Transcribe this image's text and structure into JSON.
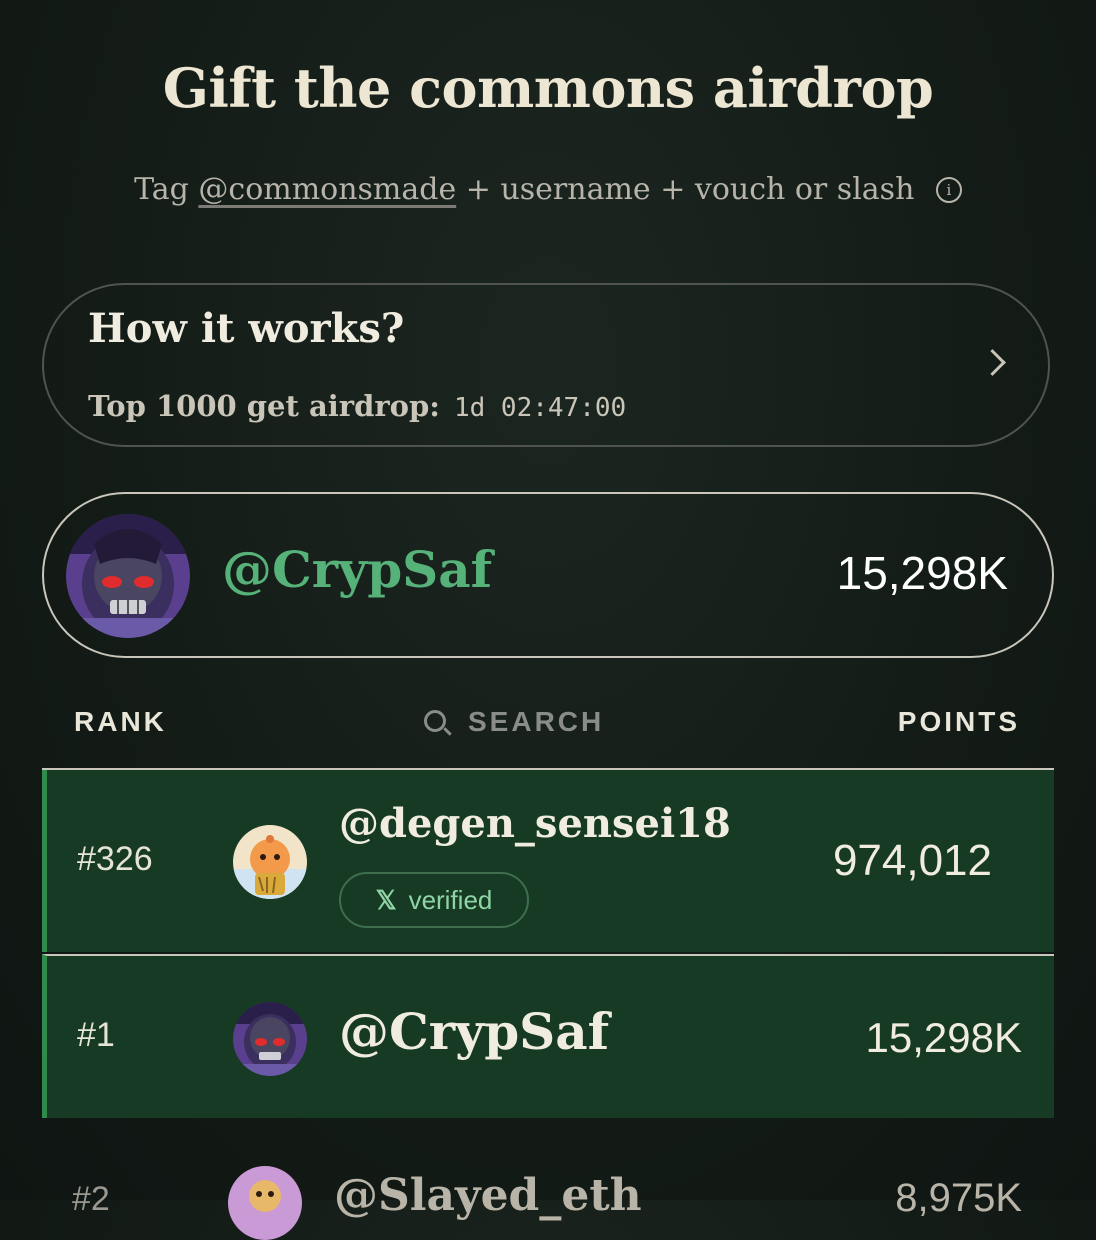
{
  "header": {
    "title": "Gift the commons airdrop",
    "subtitle_prefix": "Tag",
    "subtitle_handle": "@commonsmade",
    "subtitle_suffix": "+ username + vouch or slash",
    "info_icon": "info-icon"
  },
  "how_it_works": {
    "title": "How it works?",
    "subtitle": "Top 1000 get airdrop:",
    "timer": "1d 02:47:00",
    "chevron_icon": "chevron-right-icon"
  },
  "current_user": {
    "username": "@CrypSaf",
    "points": "15,298K",
    "avatar_icon": "avatar"
  },
  "table_header": {
    "rank": "RANK",
    "search": "SEARCH",
    "points": "POINTS"
  },
  "rows": [
    {
      "rank": "#326",
      "username": "@degen_sensei18",
      "points": "974,012",
      "badge": "verified",
      "badge_icon": "x-logo-icon"
    },
    {
      "rank": "#1",
      "username": "@CrypSaf",
      "points": "15,298K"
    },
    {
      "rank": "#2",
      "username": "@Slayed_eth",
      "points": "8,975K"
    }
  ],
  "colors": {
    "background": "#141c17",
    "accent_green": "#57b27a",
    "highlight_row": "#163a24"
  }
}
